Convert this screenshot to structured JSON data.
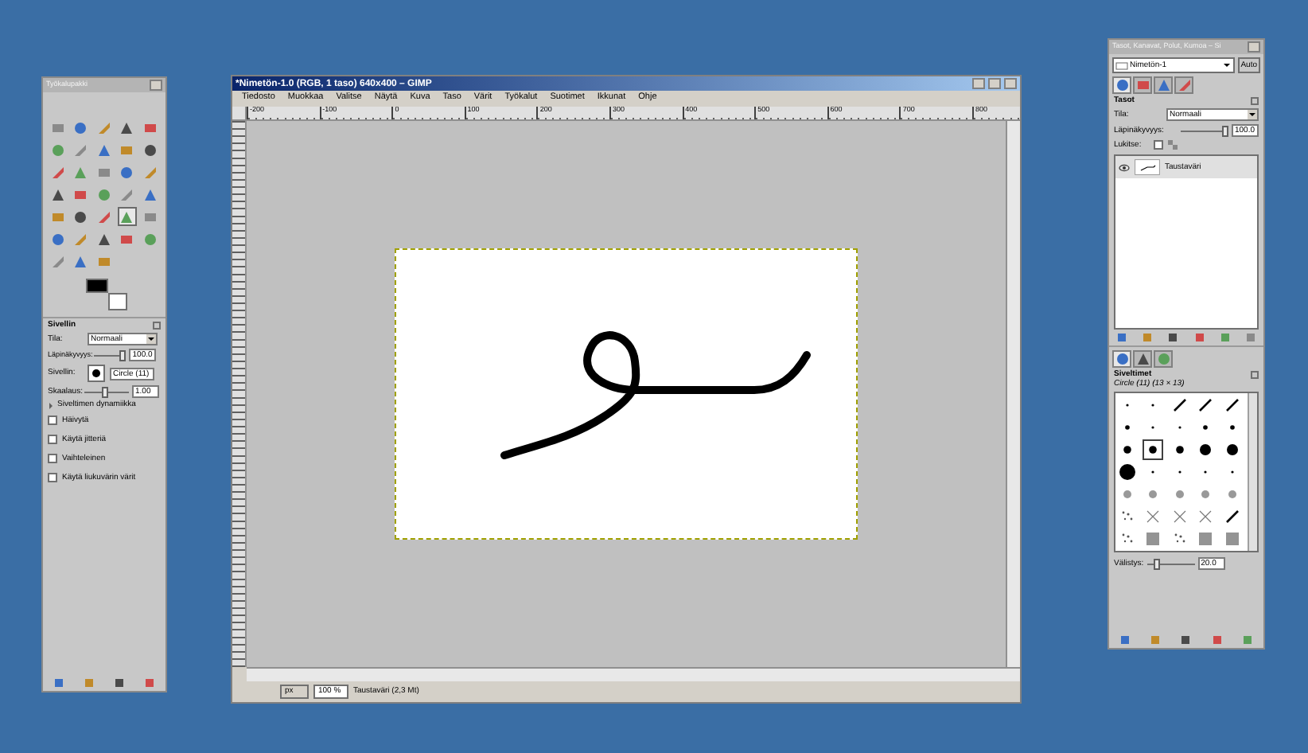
{
  "toolbox": {
    "title": "Työkalupakki",
    "tools": [
      {
        "selected": false
      },
      {
        "selected": false
      },
      {
        "selected": false
      },
      {
        "selected": false
      },
      {
        "selected": false
      },
      {
        "selected": false
      },
      {
        "selected": false
      },
      {
        "selected": false
      },
      {
        "selected": false
      },
      {
        "selected": false
      },
      {
        "selected": false
      },
      {
        "selected": false
      },
      {
        "selected": false
      },
      {
        "selected": false
      },
      {
        "selected": false
      },
      {
        "selected": false
      },
      {
        "selected": false
      },
      {
        "selected": false
      },
      {
        "selected": false
      },
      {
        "selected": false
      },
      {
        "selected": false
      },
      {
        "selected": false
      },
      {
        "selected": false
      },
      {
        "selected": true
      },
      {
        "selected": false
      },
      {
        "selected": false
      },
      {
        "selected": false
      },
      {
        "selected": false
      },
      {
        "selected": false
      },
      {
        "selected": false
      },
      {
        "selected": false
      },
      {
        "selected": false
      },
      {
        "selected": false
      }
    ],
    "options": {
      "title": "Sivellin",
      "mode_label": "Tila:",
      "mode": "Normaali",
      "opacity_label": "Läpinäkyvyys:",
      "opacity": {
        "value": "100.0",
        "level": 1
      },
      "brush_label": "Sivellin:",
      "brush": "Circle (11)",
      "scale_label": "Skaalaus:",
      "scale": {
        "value": "1.00",
        "level": 0.45
      },
      "dynamics": {
        "label": "Siveltimen dynamiikka",
        "expanded": false
      },
      "checkboxes": [
        {
          "label": "Häivytä",
          "checked": false
        },
        {
          "label": "Käytä jitteriä",
          "checked": false
        },
        {
          "label": "Vaihteleinen",
          "checked": false
        },
        {
          "label": "Käytä liukuvärin värit",
          "checked": false
        }
      ]
    }
  },
  "image_window": {
    "title": "*Nimetön-1.0 (RGB, 1 taso) 640x400 – GIMP",
    "menu": [
      "Tiedosto",
      "Muokkaa",
      "Valitse",
      "Näytä",
      "Kuva",
      "Taso",
      "Värit",
      "Työkalut",
      "Suotimet",
      "Ikkunat",
      "Ohje"
    ],
    "ruler_labels": [
      "-200",
      "-100",
      "0",
      "100",
      "200",
      "300",
      "400",
      "500",
      "600",
      "700",
      "800"
    ],
    "unit": "px",
    "zoom": "100 %",
    "status": "Taustaväri (2,3 Mt)"
  },
  "dock": {
    "title": "Tasot, Kanavat, Polut, Kumoa – Si",
    "image": "Nimetön-1",
    "auto": "Auto",
    "tabs": [
      {
        "selected": true
      },
      {
        "selected": false
      },
      {
        "selected": false
      },
      {
        "selected": false
      }
    ],
    "layers": {
      "title": "Tasot",
      "mode_label": "Tila:",
      "mode": "Normaali",
      "opacity_label": "Läpinäkyvyys:",
      "opacity": {
        "value": "100.0",
        "level": 1
      },
      "lock_label": "Lukitse:",
      "locked": false,
      "items": [
        {
          "name": "Taustaväri",
          "visible": true,
          "selected": true
        }
      ]
    },
    "brush_tabs": [
      {
        "selected": true
      },
      {
        "selected": false
      },
      {
        "selected": false
      }
    ],
    "brushes": {
      "title": "Siveltimet",
      "info": "Circle (11) (13 × 13)",
      "items": [
        {
          "kind": "tiny",
          "selected": false
        },
        {
          "kind": "tiny",
          "selected": false
        },
        {
          "kind": "line",
          "selected": false
        },
        {
          "kind": "line",
          "selected": false
        },
        {
          "kind": "line",
          "selected": false
        },
        {
          "kind": "small",
          "selected": false
        },
        {
          "kind": "tiny",
          "selected": false
        },
        {
          "kind": "tiny",
          "selected": false
        },
        {
          "kind": "small",
          "selected": false
        },
        {
          "kind": "small",
          "selected": false
        },
        {
          "kind": "medium",
          "selected": false
        },
        {
          "kind": "medium",
          "selected": true
        },
        {
          "kind": "medium",
          "selected": false
        },
        {
          "kind": "large",
          "selected": false
        },
        {
          "kind": "large",
          "selected": false
        },
        {
          "kind": "huge",
          "selected": false
        },
        {
          "kind": "tiny",
          "selected": false
        },
        {
          "kind": "tiny",
          "selected": false
        },
        {
          "kind": "tiny",
          "selected": false
        },
        {
          "kind": "tiny",
          "selected": false
        },
        {
          "kind": "soft",
          "selected": false
        },
        {
          "kind": "soft",
          "selected": false
        },
        {
          "kind": "soft",
          "selected": false
        },
        {
          "kind": "soft",
          "selected": false
        },
        {
          "kind": "soft",
          "selected": false
        },
        {
          "kind": "splatter",
          "selected": false
        },
        {
          "kind": "cross",
          "selected": false
        },
        {
          "kind": "cross",
          "selected": false
        },
        {
          "kind": "cross",
          "selected": false
        },
        {
          "kind": "line",
          "selected": false
        },
        {
          "kind": "splatter",
          "selected": false
        },
        {
          "kind": "texture",
          "selected": false
        },
        {
          "kind": "splatter",
          "selected": false
        },
        {
          "kind": "texture",
          "selected": false
        },
        {
          "kind": "texture",
          "selected": false
        }
      ],
      "spacing_label": "Välistys:",
      "spacing": {
        "value": "20.0",
        "level": 0.15
      }
    }
  }
}
